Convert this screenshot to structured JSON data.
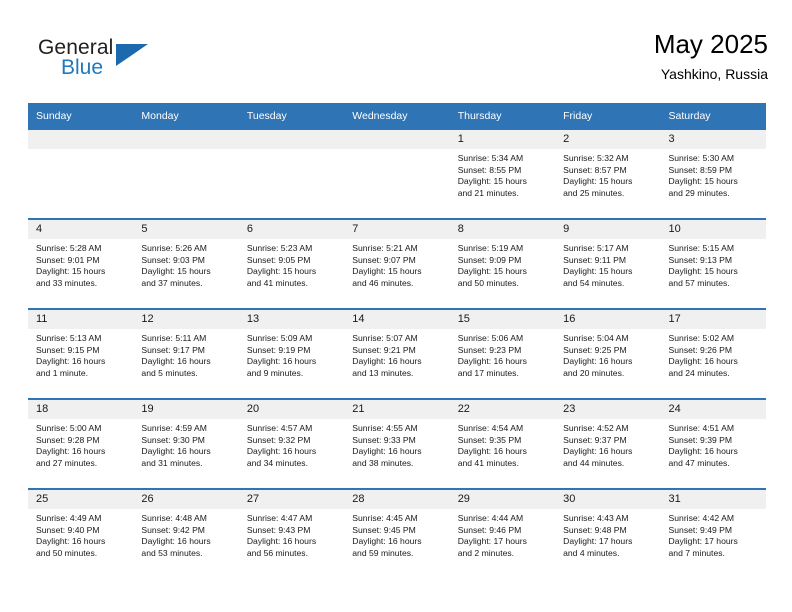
{
  "logo": {
    "line1": "General",
    "line2": "Blue",
    "accent_color": "#1a6aad"
  },
  "header": {
    "title": "May 2025",
    "location": "Yashkino, Russia"
  },
  "theme": {
    "header_blue": "#2f74b5",
    "daynum_background": "#f0f0f0"
  },
  "weekday_headers": [
    "Sunday",
    "Monday",
    "Tuesday",
    "Wednesday",
    "Thursday",
    "Friday",
    "Saturday"
  ],
  "labels": {
    "sunrise": "Sunrise:",
    "sunset": "Sunset:",
    "daylight": "Daylight:"
  },
  "weeks": [
    [
      {
        "day": "",
        "sunrise": "",
        "sunset": "",
        "daylight_line1": "",
        "daylight_line2": ""
      },
      {
        "day": "",
        "sunrise": "",
        "sunset": "",
        "daylight_line1": "",
        "daylight_line2": ""
      },
      {
        "day": "",
        "sunrise": "",
        "sunset": "",
        "daylight_line1": "",
        "daylight_line2": ""
      },
      {
        "day": "",
        "sunrise": "",
        "sunset": "",
        "daylight_line1": "",
        "daylight_line2": ""
      },
      {
        "day": "1",
        "sunrise": "Sunrise: 5:34 AM",
        "sunset": "Sunset: 8:55 PM",
        "daylight_line1": "Daylight: 15 hours",
        "daylight_line2": "and 21 minutes."
      },
      {
        "day": "2",
        "sunrise": "Sunrise: 5:32 AM",
        "sunset": "Sunset: 8:57 PM",
        "daylight_line1": "Daylight: 15 hours",
        "daylight_line2": "and 25 minutes."
      },
      {
        "day": "3",
        "sunrise": "Sunrise: 5:30 AM",
        "sunset": "Sunset: 8:59 PM",
        "daylight_line1": "Daylight: 15 hours",
        "daylight_line2": "and 29 minutes."
      }
    ],
    [
      {
        "day": "4",
        "sunrise": "Sunrise: 5:28 AM",
        "sunset": "Sunset: 9:01 PM",
        "daylight_line1": "Daylight: 15 hours",
        "daylight_line2": "and 33 minutes."
      },
      {
        "day": "5",
        "sunrise": "Sunrise: 5:26 AM",
        "sunset": "Sunset: 9:03 PM",
        "daylight_line1": "Daylight: 15 hours",
        "daylight_line2": "and 37 minutes."
      },
      {
        "day": "6",
        "sunrise": "Sunrise: 5:23 AM",
        "sunset": "Sunset: 9:05 PM",
        "daylight_line1": "Daylight: 15 hours",
        "daylight_line2": "and 41 minutes."
      },
      {
        "day": "7",
        "sunrise": "Sunrise: 5:21 AM",
        "sunset": "Sunset: 9:07 PM",
        "daylight_line1": "Daylight: 15 hours",
        "daylight_line2": "and 46 minutes."
      },
      {
        "day": "8",
        "sunrise": "Sunrise: 5:19 AM",
        "sunset": "Sunset: 9:09 PM",
        "daylight_line1": "Daylight: 15 hours",
        "daylight_line2": "and 50 minutes."
      },
      {
        "day": "9",
        "sunrise": "Sunrise: 5:17 AM",
        "sunset": "Sunset: 9:11 PM",
        "daylight_line1": "Daylight: 15 hours",
        "daylight_line2": "and 54 minutes."
      },
      {
        "day": "10",
        "sunrise": "Sunrise: 5:15 AM",
        "sunset": "Sunset: 9:13 PM",
        "daylight_line1": "Daylight: 15 hours",
        "daylight_line2": "and 57 minutes."
      }
    ],
    [
      {
        "day": "11",
        "sunrise": "Sunrise: 5:13 AM",
        "sunset": "Sunset: 9:15 PM",
        "daylight_line1": "Daylight: 16 hours",
        "daylight_line2": "and 1 minute."
      },
      {
        "day": "12",
        "sunrise": "Sunrise: 5:11 AM",
        "sunset": "Sunset: 9:17 PM",
        "daylight_line1": "Daylight: 16 hours",
        "daylight_line2": "and 5 minutes."
      },
      {
        "day": "13",
        "sunrise": "Sunrise: 5:09 AM",
        "sunset": "Sunset: 9:19 PM",
        "daylight_line1": "Daylight: 16 hours",
        "daylight_line2": "and 9 minutes."
      },
      {
        "day": "14",
        "sunrise": "Sunrise: 5:07 AM",
        "sunset": "Sunset: 9:21 PM",
        "daylight_line1": "Daylight: 16 hours",
        "daylight_line2": "and 13 minutes."
      },
      {
        "day": "15",
        "sunrise": "Sunrise: 5:06 AM",
        "sunset": "Sunset: 9:23 PM",
        "daylight_line1": "Daylight: 16 hours",
        "daylight_line2": "and 17 minutes."
      },
      {
        "day": "16",
        "sunrise": "Sunrise: 5:04 AM",
        "sunset": "Sunset: 9:25 PM",
        "daylight_line1": "Daylight: 16 hours",
        "daylight_line2": "and 20 minutes."
      },
      {
        "day": "17",
        "sunrise": "Sunrise: 5:02 AM",
        "sunset": "Sunset: 9:26 PM",
        "daylight_line1": "Daylight: 16 hours",
        "daylight_line2": "and 24 minutes."
      }
    ],
    [
      {
        "day": "18",
        "sunrise": "Sunrise: 5:00 AM",
        "sunset": "Sunset: 9:28 PM",
        "daylight_line1": "Daylight: 16 hours",
        "daylight_line2": "and 27 minutes."
      },
      {
        "day": "19",
        "sunrise": "Sunrise: 4:59 AM",
        "sunset": "Sunset: 9:30 PM",
        "daylight_line1": "Daylight: 16 hours",
        "daylight_line2": "and 31 minutes."
      },
      {
        "day": "20",
        "sunrise": "Sunrise: 4:57 AM",
        "sunset": "Sunset: 9:32 PM",
        "daylight_line1": "Daylight: 16 hours",
        "daylight_line2": "and 34 minutes."
      },
      {
        "day": "21",
        "sunrise": "Sunrise: 4:55 AM",
        "sunset": "Sunset: 9:33 PM",
        "daylight_line1": "Daylight: 16 hours",
        "daylight_line2": "and 38 minutes."
      },
      {
        "day": "22",
        "sunrise": "Sunrise: 4:54 AM",
        "sunset": "Sunset: 9:35 PM",
        "daylight_line1": "Daylight: 16 hours",
        "daylight_line2": "and 41 minutes."
      },
      {
        "day": "23",
        "sunrise": "Sunrise: 4:52 AM",
        "sunset": "Sunset: 9:37 PM",
        "daylight_line1": "Daylight: 16 hours",
        "daylight_line2": "and 44 minutes."
      },
      {
        "day": "24",
        "sunrise": "Sunrise: 4:51 AM",
        "sunset": "Sunset: 9:39 PM",
        "daylight_line1": "Daylight: 16 hours",
        "daylight_line2": "and 47 minutes."
      }
    ],
    [
      {
        "day": "25",
        "sunrise": "Sunrise: 4:49 AM",
        "sunset": "Sunset: 9:40 PM",
        "daylight_line1": "Daylight: 16 hours",
        "daylight_line2": "and 50 minutes."
      },
      {
        "day": "26",
        "sunrise": "Sunrise: 4:48 AM",
        "sunset": "Sunset: 9:42 PM",
        "daylight_line1": "Daylight: 16 hours",
        "daylight_line2": "and 53 minutes."
      },
      {
        "day": "27",
        "sunrise": "Sunrise: 4:47 AM",
        "sunset": "Sunset: 9:43 PM",
        "daylight_line1": "Daylight: 16 hours",
        "daylight_line2": "and 56 minutes."
      },
      {
        "day": "28",
        "sunrise": "Sunrise: 4:45 AM",
        "sunset": "Sunset: 9:45 PM",
        "daylight_line1": "Daylight: 16 hours",
        "daylight_line2": "and 59 minutes."
      },
      {
        "day": "29",
        "sunrise": "Sunrise: 4:44 AM",
        "sunset": "Sunset: 9:46 PM",
        "daylight_line1": "Daylight: 17 hours",
        "daylight_line2": "and 2 minutes."
      },
      {
        "day": "30",
        "sunrise": "Sunrise: 4:43 AM",
        "sunset": "Sunset: 9:48 PM",
        "daylight_line1": "Daylight: 17 hours",
        "daylight_line2": "and 4 minutes."
      },
      {
        "day": "31",
        "sunrise": "Sunrise: 4:42 AM",
        "sunset": "Sunset: 9:49 PM",
        "daylight_line1": "Daylight: 17 hours",
        "daylight_line2": "and 7 minutes."
      }
    ]
  ]
}
